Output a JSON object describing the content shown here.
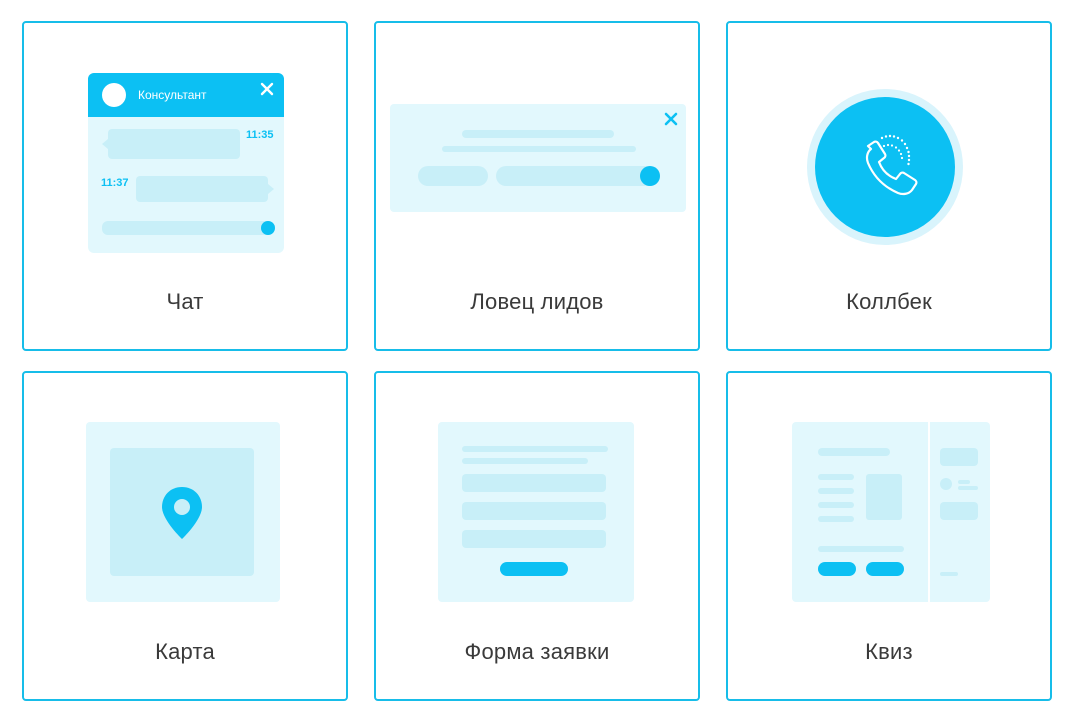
{
  "widgets": [
    {
      "label": "Чат"
    },
    {
      "label": "Ловец лидов"
    },
    {
      "label": "Коллбек"
    },
    {
      "label": "Карта"
    },
    {
      "label": "Форма заявки"
    },
    {
      "label": "Квиз"
    }
  ],
  "chat_preview": {
    "header_title": "Консультант",
    "time_1": "11:35",
    "time_2": "11:37"
  },
  "colors": {
    "accent": "#0cc0f3",
    "border": "#17bde9",
    "pale": "#e2f8fd",
    "bar": "#c8eff8"
  },
  "icons": [
    "close-icon",
    "phone-icon",
    "map-pin-icon",
    "avatar-icon"
  ]
}
